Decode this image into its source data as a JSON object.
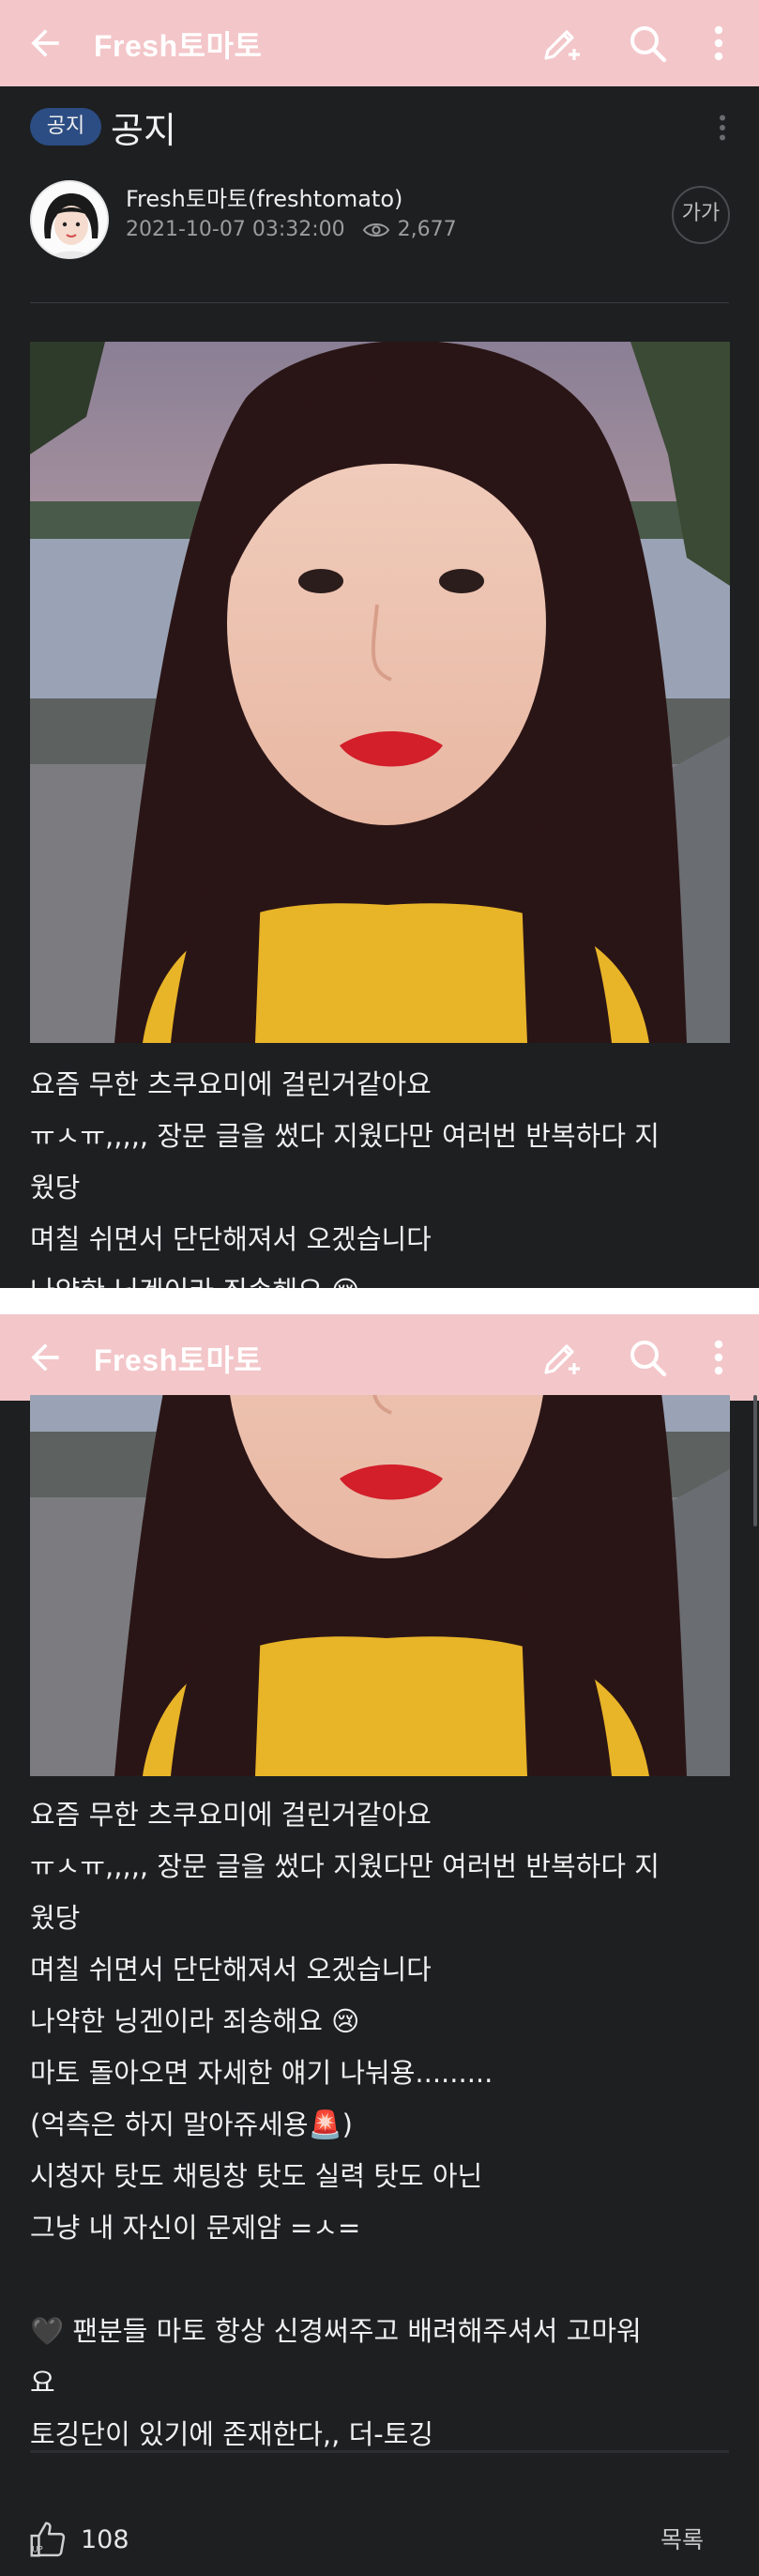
{
  "app": {
    "title": "Fresh토마토",
    "header_bg": "#f3c6c9",
    "content_bg": "#1d1f21",
    "icons": [
      "back-arrow-icon",
      "write-icon",
      "search-icon",
      "more-vert-icon"
    ]
  },
  "post": {
    "badge": "공지",
    "title": "공지",
    "author": "Fresh토마토(freshtomato)",
    "datetime": "2021-10-07 03:32:00",
    "views": "2,677",
    "font_size_button": "가가",
    "lines_screen1": [
      "요즘 무한 츠쿠요미에 걸린거같아요",
      "ㅠㅅㅠ,,,,, 장문 글을 썼다 지웠다만 여러번 반복하다 지",
      "웠당",
      "며칠 쉬면서 단단해져서 오겠습니다",
      "나약한 닝겐이라 죄송해요 😢"
    ],
    "lines_screen2": [
      "요즘 무한 츠쿠요미에 걸린거같아요",
      "ㅠㅅㅠ,,,,, 장문 글을 썼다 지웠다만 여러번 반복하다 지",
      "웠당",
      "며칠 쉬면서 단단해져서 오겠습니다",
      "나약한 닝겐이라 죄송해요 😢",
      "마토 돌아오면 자세한 얘기 나눠용.........",
      "(억측은 하지 말아쥬세용🚨)",
      "시청자 탓도 채팅창 탓도 실력 탓도 아닌",
      "그냥 내 자신이 문제얌 =ㅅ=",
      "",
      "🖤 팬분들 마토 항상 신경써주고 배려해주셔서 고마워",
      "요",
      "토깅단이 있기에 존재한다,, 더-토깅"
    ]
  },
  "footer": {
    "like_count": "108",
    "list_label": "목록"
  }
}
